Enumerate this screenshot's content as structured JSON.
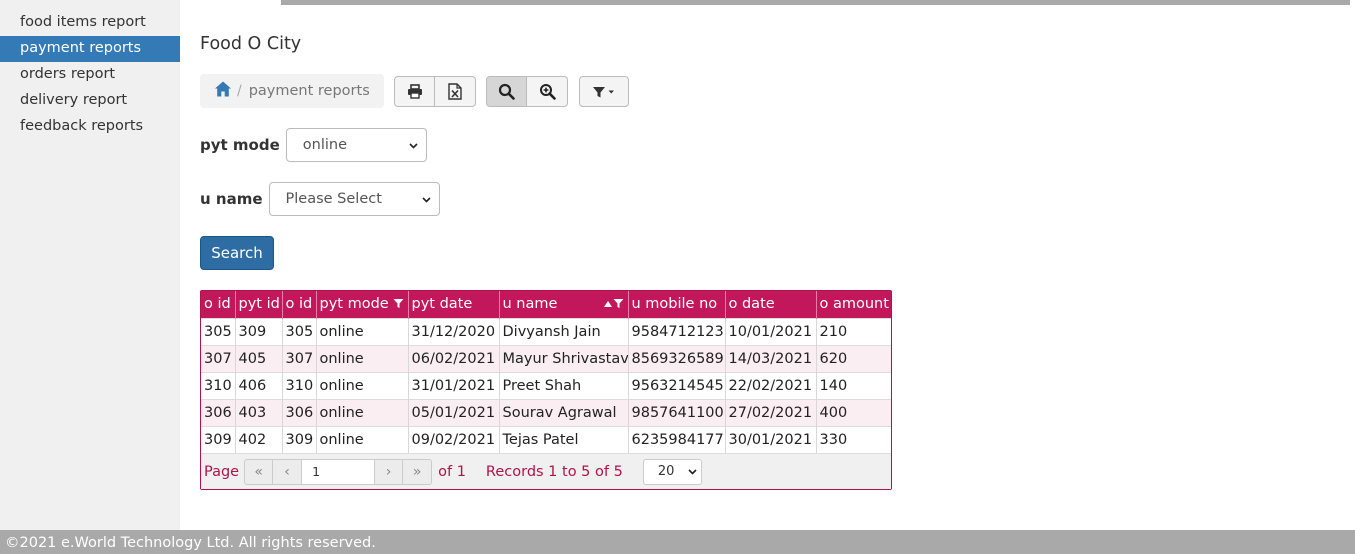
{
  "sidebar": {
    "items": [
      {
        "label": "food items report"
      },
      {
        "label": "payment reports"
      },
      {
        "label": "orders report"
      },
      {
        "label": "delivery report"
      },
      {
        "label": "feedback reports"
      }
    ],
    "active_index": 1
  },
  "app": {
    "title": "Food O City"
  },
  "breadcrumb": {
    "sep": "/",
    "current": "payment reports"
  },
  "toolbar": {
    "icons": [
      "print-icon",
      "excel-export-icon",
      "search-icon",
      "advanced-search-icon",
      "filter-dropdown-icon"
    ]
  },
  "filters": {
    "pyt_mode": {
      "label": "pyt mode",
      "value": "online"
    },
    "u_name": {
      "label": "u name",
      "value": "Please Select"
    },
    "search_label": "Search"
  },
  "table": {
    "columns": [
      "o id",
      "pyt id",
      "o id",
      "pyt mode",
      "pyt date",
      "u name",
      "u mobile no",
      "o date",
      "o amount"
    ],
    "rows": [
      [
        "305",
        "309",
        "305",
        "online",
        "31/12/2020",
        "Divyansh Jain",
        "9584712123",
        "10/01/2021",
        "210"
      ],
      [
        "307",
        "405",
        "307",
        "online",
        "06/02/2021",
        "Mayur Shrivastav",
        "8569326589",
        "14/03/2021",
        "620"
      ],
      [
        "310",
        "406",
        "310",
        "online",
        "31/01/2021",
        "Preet Shah",
        "9563214545",
        "22/02/2021",
        "140"
      ],
      [
        "306",
        "403",
        "306",
        "online",
        "05/01/2021",
        "Sourav Agrawal",
        "9857641100",
        "27/02/2021",
        "400"
      ],
      [
        "309",
        "402",
        "309",
        "online",
        "09/02/2021",
        "Tejas Patel",
        "6235984177",
        "30/01/2021",
        "330"
      ]
    ]
  },
  "pager": {
    "page_label": "Page",
    "page_value": "1",
    "of_label": "of 1",
    "records": "Records 1 to 5 of 5",
    "page_size": "20"
  },
  "footer": {
    "text": "©2021 e.World Technology Ltd. All rights reserved."
  },
  "colors": {
    "accent": "#337ab7",
    "grid_header": "#c2185b",
    "pager_text": "#b0124a",
    "footer_bg": "#a9a9a9"
  }
}
